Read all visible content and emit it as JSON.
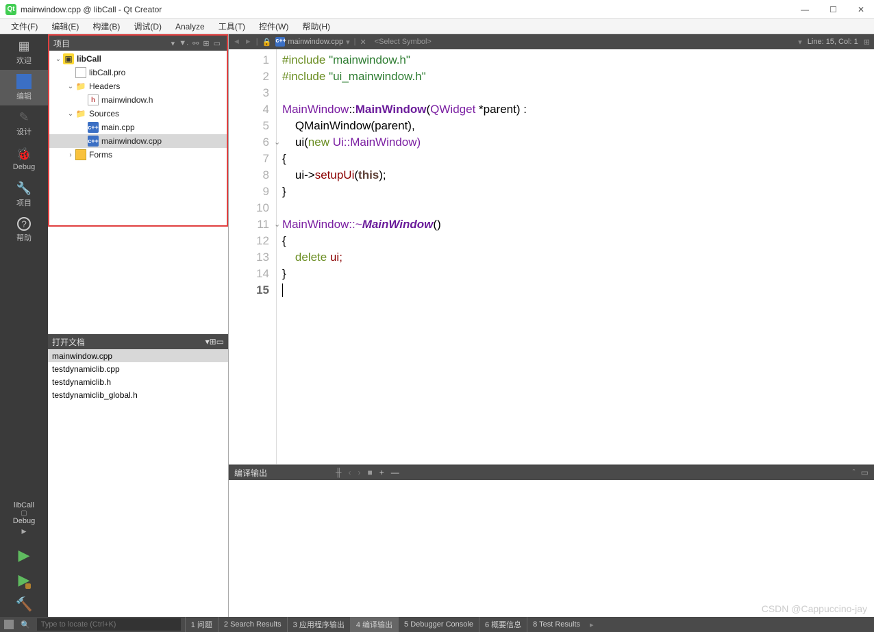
{
  "window": {
    "title": "mainwindow.cpp @ libCall - Qt Creator"
  },
  "menus": [
    "文件(F)",
    "编辑(E)",
    "构建(B)",
    "调试(D)",
    "Analyze",
    "工具(T)",
    "控件(W)",
    "帮助(H)"
  ],
  "modes": {
    "welcome": "欢迎",
    "edit": "编辑",
    "design": "设计",
    "debug": "Debug",
    "project": "项目",
    "help": "帮助",
    "kit": "libCall",
    "config": "Debug"
  },
  "projectPanel": {
    "title": "项目",
    "tree": [
      {
        "lvl": 0,
        "arrow": "v",
        "icon": "proj",
        "label": "libCall",
        "bold": true
      },
      {
        "lvl": 1,
        "arrow": "",
        "icon": "file",
        "label": "libCall.pro"
      },
      {
        "lvl": 1,
        "arrow": "v",
        "icon": "folder",
        "label": "Headers"
      },
      {
        "lvl": 2,
        "arrow": "",
        "icon": "h",
        "label": "mainwindow.h"
      },
      {
        "lvl": 1,
        "arrow": "v",
        "icon": "folder",
        "label": "Sources"
      },
      {
        "lvl": 2,
        "arrow": "",
        "icon": "cpp",
        "label": "main.cpp"
      },
      {
        "lvl": 2,
        "arrow": "",
        "icon": "cpp",
        "label": "mainwindow.cpp",
        "selected": true
      },
      {
        "lvl": 1,
        "arrow": ">",
        "icon": "form",
        "label": "Forms"
      }
    ]
  },
  "openDocs": {
    "title": "打开文档",
    "items": [
      {
        "label": "mainwindow.cpp",
        "selected": true
      },
      {
        "label": "testdynamiclib.cpp"
      },
      {
        "label": "testdynamiclib.h"
      },
      {
        "label": "testdynamiclib_global.h"
      }
    ]
  },
  "editor": {
    "filename": "mainwindow.cpp",
    "symbol": "<Select Symbol>",
    "cursor": "Line: 15, Col: 1",
    "lineCount": 15,
    "currentLine": 15,
    "code": {
      "l1_kw": "#include ",
      "l1_str": "\"mainwindow.h\"",
      "l2_kw": "#include ",
      "l2_str": "\"ui_mainwindow.h\"",
      "l4_a": "MainWindow",
      "l4_b": "::",
      "l4_c": "MainWindow",
      "l4_d": "(",
      "l4_e": "QWidget",
      "l4_f": " *parent) :",
      "l5": "    QMainWindow(parent),",
      "l6_a": "    ui(",
      "l6_b": "new",
      "l6_c": " Ui::MainWindow)",
      "l7": "{",
      "l8_a": "    ui->",
      "l8_b": "setupUi",
      "l8_c": "(",
      "l8_d": "this",
      "l8_e": ");",
      "l9": "}",
      "l11_a": "MainWindow::~",
      "l11_b": "MainWindow",
      "l11_c": "()",
      "l12": "{",
      "l13_a": "    ",
      "l13_b": "delete",
      "l13_c": " ui;",
      "l14": "}"
    }
  },
  "outputPanel": {
    "title": "编译输出"
  },
  "statusbar": {
    "searchPlaceholder": "Type to locate (Ctrl+K)",
    "panes": [
      {
        "n": "1",
        "label": "问题"
      },
      {
        "n": "2",
        "label": "Search Results"
      },
      {
        "n": "3",
        "label": "应用程序输出"
      },
      {
        "n": "4",
        "label": "编译输出",
        "active": true
      },
      {
        "n": "5",
        "label": "Debugger Console"
      },
      {
        "n": "6",
        "label": "概要信息"
      },
      {
        "n": "8",
        "label": "Test Results"
      }
    ]
  },
  "watermark": "CSDN @Cappuccino-jay"
}
